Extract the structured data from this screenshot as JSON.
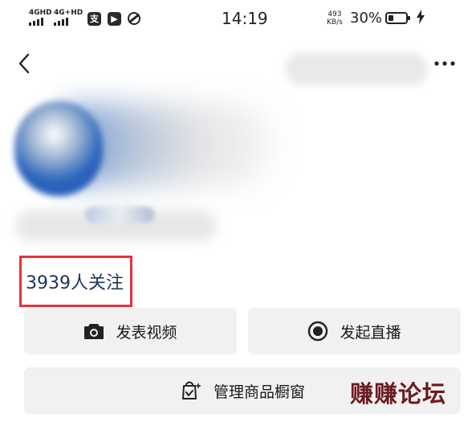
{
  "status_bar": {
    "signal1": "4GHD",
    "signal2": "4G+HD",
    "time": "14:19",
    "speed_value": "493",
    "speed_unit": "KB/s",
    "battery": "30%"
  },
  "profile": {
    "followers_text": "3939人关注"
  },
  "actions": {
    "post_video": "发表视频",
    "start_live": "发起直播",
    "manage_shop": "管理商品橱窗"
  },
  "watermark": "赚赚论坛",
  "colors": {
    "highlight_border": "#e8313a",
    "followers_text": "#1d3557",
    "button_bg": "#f1f1f1",
    "watermark": "#6d1a1e"
  },
  "icons": [
    "back-arrow-icon",
    "more-dots-icon",
    "camera-icon",
    "record-icon",
    "shopping-bag-icon",
    "charging-bolt-icon"
  ]
}
